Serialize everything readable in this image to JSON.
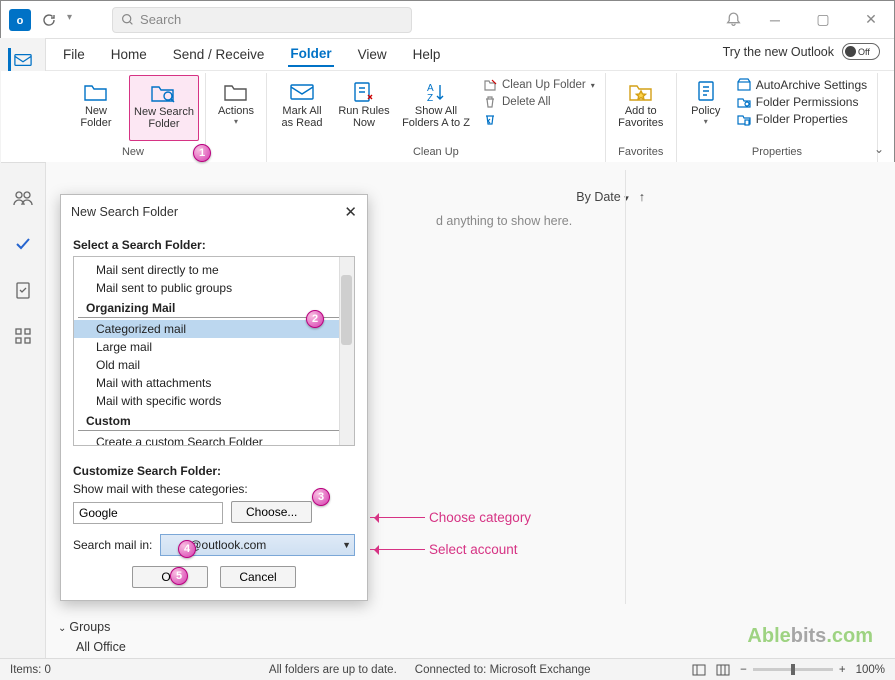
{
  "titlebar": {
    "search_placeholder": "Search"
  },
  "tabs": {
    "file": "File",
    "home": "Home",
    "sendreceive": "Send / Receive",
    "folder": "Folder",
    "view": "View",
    "help": "Help"
  },
  "try_text": "Try the new Outlook",
  "toggle_off": "Off",
  "ribbon": {
    "new_folder": "New\nFolder",
    "new_search_folder": "New Search\nFolder",
    "actions": "Actions",
    "mark_all_read": "Mark All\nas Read",
    "run_rules": "Run Rules\nNow",
    "show_all": "Show All\nFolders A to Z",
    "cleanup_folder": "Clean Up Folder",
    "delete_all": "Delete All",
    "add_favorites": "Add to\nFavorites",
    "policy": "Policy",
    "autoarchive": "AutoArchive Settings",
    "folder_perm": "Folder Permissions",
    "folder_prop": "Folder Properties",
    "g_new": "New",
    "g_cleanup": "Clean Up",
    "g_fav": "Favorites",
    "g_prop": "Properties"
  },
  "msglist": {
    "sort": "By Date",
    "empty": "d anything to show here."
  },
  "dialog": {
    "title": "New Search Folder",
    "sel_label": "Select a Search Folder:",
    "items": {
      "direct": "Mail sent directly to me",
      "public": "Mail sent to public groups",
      "organizing": "Organizing Mail",
      "categorized": "Categorized mail",
      "large": "Large mail",
      "old": "Old mail",
      "attach": "Mail with attachments",
      "words": "Mail with specific words",
      "custom_h": "Custom",
      "custom": "Create a custom Search Folder"
    },
    "cust_label": "Customize Search Folder:",
    "show_cat": "Show mail with these categories:",
    "cat_value": "Google",
    "choose": "Choose...",
    "search_in": "Search mail in:",
    "account": "@outlook.com",
    "ok": "OK",
    "cancel": "Cancel"
  },
  "callouts": {
    "choose": "Choose category",
    "account": "Select account"
  },
  "badges": {
    "b1": "1",
    "b2": "2",
    "b3": "3",
    "b4": "4",
    "b5": "5"
  },
  "groups": {
    "groups": "Groups",
    "alloffice": "All Office"
  },
  "watermark": {
    "t1": "Able",
    "t2": "bits",
    "t3": ".com"
  },
  "status": {
    "items": "Items: 0",
    "uptodate": "All folders are up to date.",
    "conn": "Connected to: Microsoft Exchange",
    "zoom": "100%"
  }
}
